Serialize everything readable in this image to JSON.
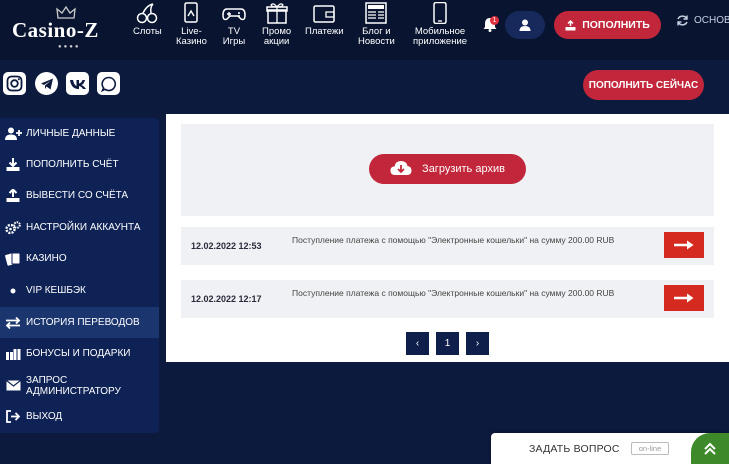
{
  "header": {
    "logo_text": "Casino-Z",
    "logo_dots": "●●●●",
    "nav": [
      {
        "label": "Слоты",
        "icon": "cherries-icon"
      },
      {
        "label": "Live-\nКазино",
        "icon": "live-casino-icon"
      },
      {
        "label": "TV\nИгры",
        "icon": "gamepad-icon"
      },
      {
        "label": "Промо\nакции",
        "icon": "gift-icon"
      },
      {
        "label": "Платежи",
        "icon": "wallet-icon"
      },
      {
        "label": "Блог и\nНовости",
        "icon": "news-icon"
      },
      {
        "label": "Мобильное\nприложение",
        "icon": "smartphone-icon"
      }
    ],
    "notifications_count": "1",
    "deposit_label": "ПОПОЛНИТЬ",
    "refresh_label": "ОСНОВ"
  },
  "social": [
    "instagram-icon",
    "telegram-icon",
    "vk-icon",
    "whatsapp-icon"
  ],
  "deposit_now_label": "ПОПОЛНИТЬ СЕЙЧАС",
  "sidebar": {
    "items": [
      {
        "label": "ЛИЧНЫЕ ДАННЫЕ",
        "icon": "user-plus-icon"
      },
      {
        "label": "ПОПОЛНИТЬ СЧЁТ",
        "icon": "download-icon"
      },
      {
        "label": "ВЫВЕСТИ СО СЧЁТА",
        "icon": "upload-icon"
      },
      {
        "label": "НАСТРОЙКИ АККАУНТА",
        "icon": "gears-icon"
      },
      {
        "label": "КАЗИНО",
        "icon": "cards-icon"
      },
      {
        "label": "VIP КЕШБЭК",
        "icon": "dot-icon"
      },
      {
        "label": "ИСТОРИЯ ПЕРЕВОДОВ",
        "icon": "transfer-icon"
      },
      {
        "label": "БОНУСЫ И ПОДАРКИ",
        "icon": "gifts-icon"
      },
      {
        "label": "ЗАПРОС\nАДМИНИСТРАТОРУ",
        "icon": "envelope-icon"
      },
      {
        "label": "ВЫХОД",
        "icon": "logout-icon"
      }
    ],
    "active_index": 6
  },
  "content": {
    "upload_label": "Загрузить архив",
    "transactions": [
      {
        "date": "12.02.2022 12:53",
        "description": "Поступление платежа с помощью \"Электронные кошельки\" на сумму 200.00 RUB"
      },
      {
        "date": "12.02.2022 12:17",
        "description": "Поступление платежа с помощью \"Электронные кошельки\" на сумму 200.00 RUB"
      }
    ],
    "pagination": {
      "prev": "‹",
      "page": "1",
      "next": "›"
    }
  },
  "ask_widget": {
    "label": "ЗАДАТЬ ВОПРОС",
    "status": "on-line"
  },
  "colors": {
    "background": "#0c1a3e",
    "header": "#081430",
    "accent_red": "#c2263a",
    "arrow_red": "#d52a1f",
    "sidebar": "#0e2255",
    "online_green": "#3e8a2b"
  }
}
